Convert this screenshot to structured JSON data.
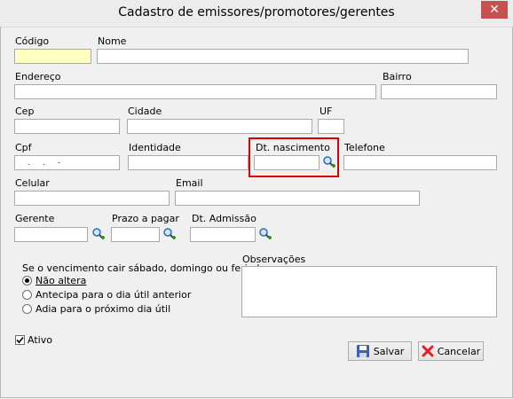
{
  "window": {
    "title": "Cadastro de emissores/promotores/gerentes",
    "close_glyph": "✕"
  },
  "fields": {
    "codigo": {
      "label": "Código",
      "value": ""
    },
    "nome": {
      "label": "Nome",
      "value": ""
    },
    "endereco": {
      "label": "Endereço",
      "value": ""
    },
    "bairro": {
      "label": "Bairro",
      "value": ""
    },
    "cep": {
      "label": "Cep",
      "value": ""
    },
    "cidade": {
      "label": "Cidade",
      "value": ""
    },
    "uf": {
      "label": "UF",
      "value": ""
    },
    "cpf": {
      "label": "Cpf",
      "value": ". . -"
    },
    "identidade": {
      "label": "Identidade",
      "value": ""
    },
    "dt_nascimento": {
      "label": "Dt. nascimento",
      "value": ""
    },
    "telefone": {
      "label": "Telefone",
      "value": ""
    },
    "celular": {
      "label": "Celular",
      "value": ""
    },
    "email": {
      "label": "Email",
      "value": ""
    },
    "gerente": {
      "label": "Gerente",
      "value": ""
    },
    "prazo": {
      "label": "Prazo a pagar",
      "value": ""
    },
    "dt_admissao": {
      "label": "Dt. Admissão",
      "value": ""
    },
    "observacoes": {
      "label": "Observações",
      "value": ""
    }
  },
  "vencimento": {
    "label": "Se o vencimento cair sábado, domingo ou feriado",
    "options": [
      "Não altera",
      "Antecipa para o dia útil anterior",
      "Adia para o próximo dia útil"
    ],
    "selected": 0
  },
  "ativo": {
    "label": "Ativo",
    "checked": true
  },
  "buttons": {
    "save": "Salvar",
    "cancel": "Cancelar"
  },
  "icons": {
    "lookup": "magnifier-plus-icon",
    "save": "floppy-disk-icon",
    "cancel": "red-x-icon"
  },
  "colors": {
    "highlight": "#e00000",
    "required_field": "#ffffc0"
  }
}
